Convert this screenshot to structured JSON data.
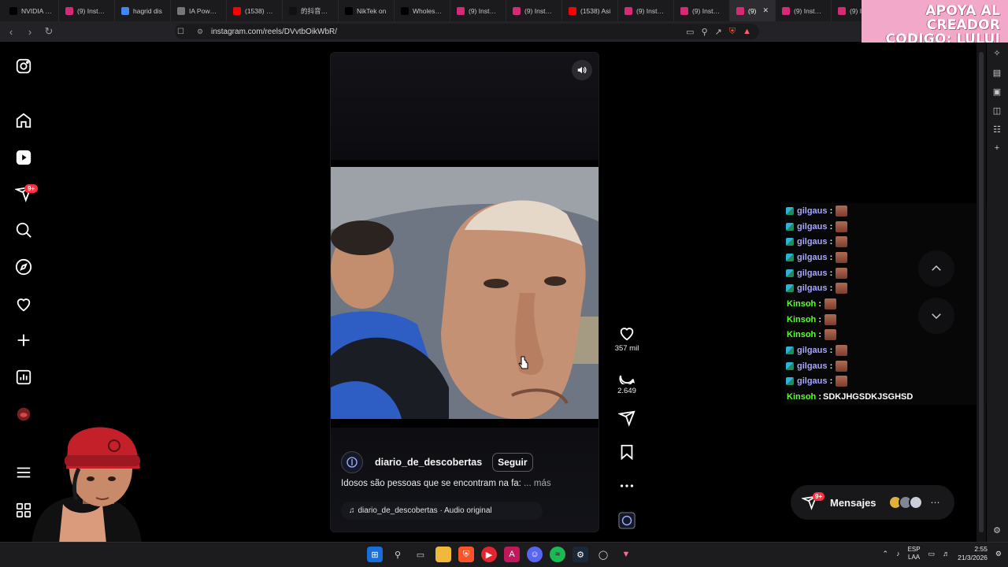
{
  "browser": {
    "tabs": [
      {
        "title": "NVIDIA y F",
        "color": "#000000"
      },
      {
        "title": "(9) Instagra",
        "color": "#d62976"
      },
      {
        "title": "hagrid dis",
        "color": "#4285f4"
      },
      {
        "title": "IA Power II",
        "color": "#777777"
      },
      {
        "title": "(1538) DLS",
        "color": "#ff0000"
      },
      {
        "title": "的抖音直播",
        "color": "#111111"
      },
      {
        "title": "NikTek on",
        "color": "#000000"
      },
      {
        "title": "Wholesom",
        "color": "#000000"
      },
      {
        "title": "(9) Instagra",
        "color": "#d62976"
      },
      {
        "title": "(9) Instagra",
        "color": "#d62976"
      },
      {
        "title": "(1538) Asi",
        "color": "#ff0000"
      },
      {
        "title": "(9) Instagra",
        "color": "#d62976"
      },
      {
        "title": "(9) Instagra",
        "color": "#d62976"
      },
      {
        "title": "(9)",
        "color": "#d62976",
        "active": true
      },
      {
        "title": "(9) Instagra",
        "color": "#d62976"
      },
      {
        "title": "(9) Instagra",
        "color": "#d62976"
      }
    ],
    "url": "instagram.com/reels/DVvtbOikWbR/"
  },
  "promo": {
    "line1": "APOYA AL CREADOR",
    "line2": "CODIGO: LULUI"
  },
  "nav": {
    "notifications_badge": "9+"
  },
  "reel": {
    "author": "diario_de_descobertas",
    "follow_label": "Seguir",
    "caption": "Idosos são pessoas que se encontram na fa:",
    "more_label": "... más",
    "audio": "diario_de_descobertas · Audio original",
    "likes": "357 mil",
    "comments": "2.649"
  },
  "chat": [
    {
      "user": "gilgaus",
      "badge": true,
      "emote": true,
      "text": ""
    },
    {
      "user": "gilgaus",
      "badge": true,
      "emote": true,
      "text": ""
    },
    {
      "user": "gilgaus",
      "badge": true,
      "emote": true,
      "text": ""
    },
    {
      "user": "gilgaus",
      "badge": true,
      "emote": true,
      "text": ""
    },
    {
      "user": "gilgaus",
      "badge": true,
      "emote": true,
      "text": ""
    },
    {
      "user": "gilgaus",
      "badge": true,
      "emote": true,
      "text": ""
    },
    {
      "user": "Kinsoh",
      "badge": false,
      "emote": true,
      "text": ""
    },
    {
      "user": "Kinsoh",
      "badge": false,
      "emote": true,
      "text": ""
    },
    {
      "user": "Kinsoh",
      "badge": false,
      "emote": true,
      "text": ""
    },
    {
      "user": "gilgaus",
      "badge": true,
      "emote": true,
      "text": ""
    },
    {
      "user": "gilgaus",
      "badge": true,
      "emote": true,
      "text": ""
    },
    {
      "user": "gilgaus",
      "badge": true,
      "emote": true,
      "text": ""
    },
    {
      "user": "Kinsoh",
      "badge": false,
      "emote": false,
      "text": "SDKJHGSDKJSGHSD"
    }
  ],
  "messages": {
    "label": "Mensajes",
    "badge": "9+"
  },
  "taskbar": {
    "lang_top": "ESP",
    "lang_bottom": "LAA",
    "time": "2:55",
    "date": "21/3/2026"
  }
}
